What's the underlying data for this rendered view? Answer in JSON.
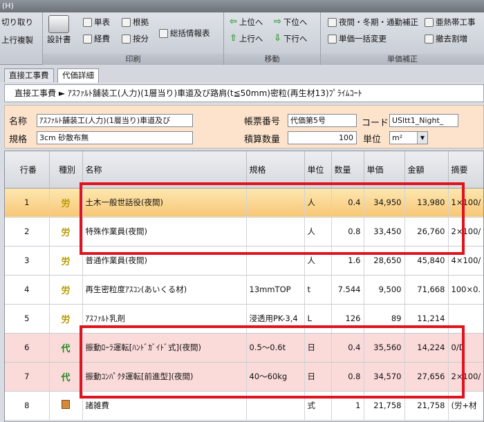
{
  "titlebar": {
    "text": "(H)"
  },
  "ribbon": {
    "groups": [
      {
        "label": "",
        "buttons": [
          "切り取り",
          "上行複製"
        ]
      },
      {
        "label": "印刷",
        "buttons": [
          "設計書",
          "単表",
          "経費",
          "根拠",
          "按分",
          "総括情報表"
        ]
      },
      {
        "label": "移動",
        "buttons": [
          "上位へ",
          "下位へ",
          "上行へ",
          "下行へ"
        ]
      },
      {
        "label": "単価補正",
        "buttons": [
          "夜間・冬期・通勤補正",
          "亜熱帯工事",
          "単価一括変更",
          "撤去割増"
        ]
      }
    ]
  },
  "tabs": [
    "直接工事費",
    "代価詳細"
  ],
  "breadcrumb": "直接工事費 ► ｱｽﾌｧﾙﾄ舗装工(人力)(1層当り)車道及び路肩(t≦50mm)密粒(再生材13)ﾌﾟﾗｲﾑｺｰﾄ",
  "form": {
    "name_label": "名称",
    "name_value": "ｱｽﾌｧﾙﾄ舗装工(人力)(1層当り)車道及び",
    "spec_label": "規格",
    "spec_value": "3cm 砂散布無",
    "ledger_label": "帳票番号",
    "ledger_value": "代価第5号",
    "code_label": "コード",
    "code_value": "USltt1_Night_",
    "qty_label": "積算数量",
    "qty_value": "100",
    "unit_label": "単位",
    "unit_value": "m²"
  },
  "grid": {
    "headers": [
      "行番",
      "種別",
      "名称",
      "規格",
      "単位",
      "数量",
      "単価",
      "金額",
      "摘要"
    ],
    "rows": [
      {
        "no": "1",
        "kind": "労",
        "kind_type": "labor",
        "name": "土木一般世話役(夜間)",
        "spec": "",
        "unit": "人",
        "qty": "0.4",
        "price": "34,950",
        "amount": "13,980",
        "note": "1×100/"
      },
      {
        "no": "2",
        "kind": "労",
        "kind_type": "labor",
        "name": "特殊作業員(夜間)",
        "spec": "",
        "unit": "人",
        "qty": "0.8",
        "price": "33,450",
        "amount": "26,760",
        "note": "2×100/"
      },
      {
        "no": "3",
        "kind": "労",
        "kind_type": "labor",
        "name": "普通作業員(夜間)",
        "spec": "",
        "unit": "人",
        "qty": "1.6",
        "price": "28,650",
        "amount": "45,840",
        "note": "4×100/"
      },
      {
        "no": "4",
        "kind": "労",
        "kind_type": "labor",
        "name": "再生密粒度ｱｽｺﾝ(あいくる材)",
        "spec": "13mmTOP",
        "unit": "t",
        "qty": "7.544",
        "price": "9,500",
        "amount": "71,668",
        "note": "100×0."
      },
      {
        "no": "5",
        "kind": "労",
        "kind_type": "labor",
        "name": "ｱｽﾌｧﾙﾄ乳剤",
        "spec": "浸透用PK-3,4",
        "unit": "L",
        "qty": "126",
        "price": "89",
        "amount": "11,214",
        "note": ""
      },
      {
        "no": "6",
        "kind": "代",
        "kind_type": "sub",
        "name": "振動ﾛｰﾗ運転[ﾊﾝﾄﾞｶﾞｲﾄﾞ式](夜間)",
        "spec": "0.5～0.6t",
        "unit": "日",
        "qty": "0.4",
        "price": "35,560",
        "amount": "14,224",
        "note": "0/D"
      },
      {
        "no": "7",
        "kind": "代",
        "kind_type": "sub",
        "name": "振動ｺﾝﾊﾟｸﾀ運転[前進型](夜間)",
        "spec": "40～60kg",
        "unit": "日",
        "qty": "0.8",
        "price": "34,570",
        "amount": "27,656",
        "note": "2×100/"
      },
      {
        "no": "8",
        "kind": "",
        "kind_type": "misc",
        "name": "諸雑費",
        "spec": "",
        "unit": "式",
        "qty": "1",
        "price": "21,758",
        "amount": "21,758",
        "note": "(労+材"
      }
    ]
  }
}
